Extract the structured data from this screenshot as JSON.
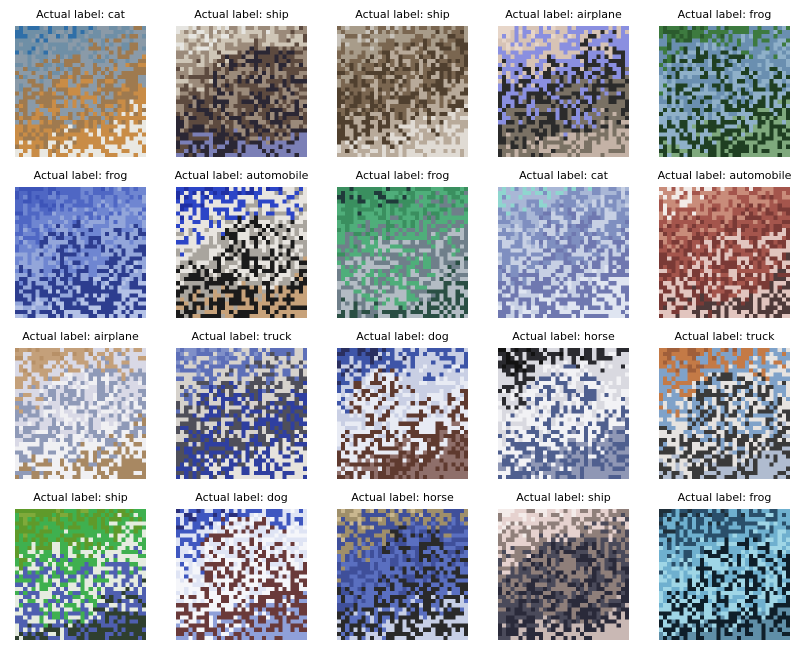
{
  "title_prefix": "Actual label: ",
  "images": [
    {
      "label": "cat",
      "title": "Actual label: cat",
      "palette": [
        "#2f6fa8",
        "#6f8fa6",
        "#8a9aa8",
        "#9f7a4f",
        "#c98c46",
        "#e9e8e2"
      ]
    },
    {
      "label": "ship",
      "title": "Actual label: ship",
      "palette": [
        "#e6e5e1",
        "#cfc6b7",
        "#9b8a7a",
        "#5d4a3f",
        "#2b2734",
        "#7b7fb6"
      ]
    },
    {
      "label": "ship",
      "title": "Actual label: ship",
      "palette": [
        "#c8c3bb",
        "#a89c8a",
        "#7a6650",
        "#50402f",
        "#b8aa9a",
        "#e0dbd4"
      ]
    },
    {
      "label": "airplane",
      "title": "Actual label: airplane",
      "palette": [
        "#e7d6c9",
        "#d7c3b5",
        "#8a8fe0",
        "#2b2b2b",
        "#7a7164",
        "#c4b2a6"
      ]
    },
    {
      "label": "frog",
      "title": "Actual label: frog",
      "palette": [
        "#2b5b2e",
        "#3d7a3f",
        "#6a8fb0",
        "#8fb0c9",
        "#1f3f22",
        "#7fa97d"
      ]
    },
    {
      "label": "frog",
      "title": "Actual label: frog",
      "palette": [
        "#3d54b8",
        "#4f67c4",
        "#6f86d1",
        "#93a6da",
        "#2d3d8f",
        "#b3c1e6"
      ]
    },
    {
      "label": "automobile",
      "title": "Actual label: automobile",
      "palette": [
        "#1f2fa3",
        "#2c45c7",
        "#e8e5e0",
        "#a9a59e",
        "#1b1b1b",
        "#c7a27a"
      ]
    },
    {
      "label": "frog",
      "title": "Actual label: frog",
      "palette": [
        "#1f3a3a",
        "#3a8f5f",
        "#4fae7a",
        "#6f7f8a",
        "#b3bcc4",
        "#2a4f44"
      ]
    },
    {
      "label": "cat",
      "title": "Actual label: cat",
      "palette": [
        "#8fd6cf",
        "#a9b7d6",
        "#7f8fc0",
        "#c7d0e4",
        "#6f78b0",
        "#dfe5f1"
      ]
    },
    {
      "label": "automobile",
      "title": "Actual label: automobile",
      "palette": [
        "#f2ebe8",
        "#c98c7a",
        "#a4554c",
        "#7a3a36",
        "#e2c5bf",
        "#4f3a3a"
      ]
    },
    {
      "label": "airplane",
      "title": "Actual label: airplane",
      "palette": [
        "#b79067",
        "#c4a07a",
        "#d9d9e6",
        "#8f9ab8",
        "#f0f0f3",
        "#a88862"
      ]
    },
    {
      "label": "truck",
      "title": "Actual label: truck",
      "palette": [
        "#7f8fc8",
        "#5d6fb8",
        "#d6d2cc",
        "#4f4f5a",
        "#2f3fa0",
        "#e6e3dd"
      ]
    },
    {
      "label": "dog",
      "title": "Actual label: dog",
      "palette": [
        "#2a2f5f",
        "#3e55a8",
        "#c9cfe4",
        "#e8ebf4",
        "#5f3a2f",
        "#8f6f6a"
      ]
    },
    {
      "label": "horse",
      "title": "Actual label: horse",
      "palette": [
        "#121212",
        "#2a2a2f",
        "#d9d9e0",
        "#f2f2f5",
        "#4f5f8f",
        "#8f97b5"
      ]
    },
    {
      "label": "truck",
      "title": "Actual label: truck",
      "palette": [
        "#a05f3a",
        "#c47a46",
        "#7fa2c9",
        "#e6e3e0",
        "#3a3a3a",
        "#b0bcd0"
      ]
    },
    {
      "label": "ship",
      "title": "Actual label: ship",
      "palette": [
        "#7faa3a",
        "#5f9a2a",
        "#3fb04f",
        "#e6ece0",
        "#4f5fb0",
        "#2f3f2f"
      ]
    },
    {
      "label": "dog",
      "title": "Actual label: dog",
      "palette": [
        "#2a2f7a",
        "#3f57c0",
        "#dfe4f4",
        "#f5f6fa",
        "#6a3a3a",
        "#8fa0d9"
      ]
    },
    {
      "label": "horse",
      "title": "Actual label: horse",
      "palette": [
        "#c9b78f",
        "#9f8f6a",
        "#3f4f9a",
        "#5a6fc0",
        "#2a2a2a",
        "#c7cfe6"
      ]
    },
    {
      "label": "ship",
      "title": "Actual label: ship",
      "palette": [
        "#f4ecea",
        "#e6d2cf",
        "#8f7f7a",
        "#4a4a5a",
        "#2a2a3a",
        "#c9b8b4"
      ]
    },
    {
      "label": "frog",
      "title": "Actual label: frog",
      "palette": [
        "#1f2f3a",
        "#2a4f6a",
        "#6fb0cf",
        "#9fd6e6",
        "#0f1f2a",
        "#5f8fa8"
      ]
    }
  ]
}
